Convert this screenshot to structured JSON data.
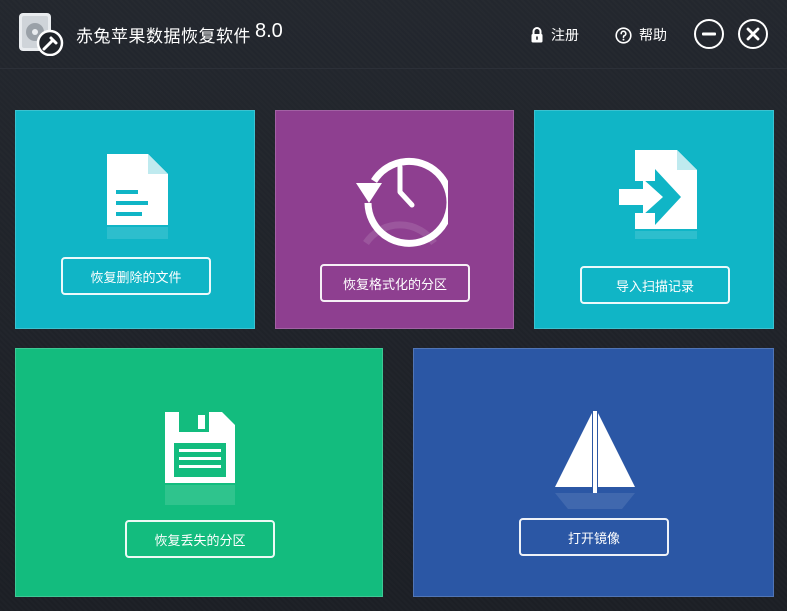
{
  "app": {
    "title": "赤兔苹果数据恢复软件",
    "version": "8.0"
  },
  "titlebar": {
    "register_label": "注册",
    "help_label": "帮助",
    "icons": {
      "register": "lock-icon",
      "help": "question-circle-icon",
      "minimize": "minimize-icon",
      "close": "close-icon"
    }
  },
  "tiles": [
    {
      "id": "recover-deleted",
      "label": "恢复删除的文件",
      "icon": "document-icon",
      "color": "#10b5c6"
    },
    {
      "id": "recover-formatted",
      "label": "恢复格式化的分区",
      "icon": "history-clock-icon",
      "color": "#8e3f90"
    },
    {
      "id": "import-scan",
      "label": "导入扫描记录",
      "icon": "import-file-icon",
      "color": "#10b5c6"
    },
    {
      "id": "recover-lost-partition",
      "label": "恢复丢失的分区",
      "icon": "floppy-disk-icon",
      "color": "#13bc7e"
    },
    {
      "id": "open-image",
      "label": "打开镜像",
      "icon": "sail-icon",
      "color": "#2b57a5"
    }
  ]
}
